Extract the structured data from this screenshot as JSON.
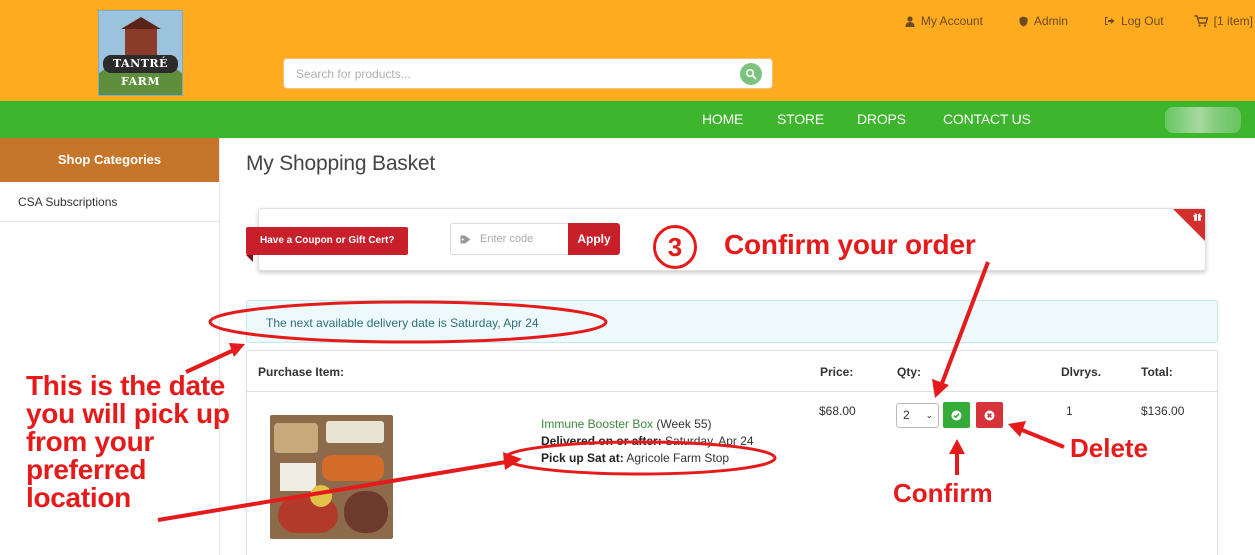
{
  "header": {
    "logo_text": "TANTRÉ FARM",
    "search_placeholder": "Search for products...",
    "account_links": [
      {
        "label": "My Account",
        "icon": "user-icon"
      },
      {
        "label": "Admin",
        "icon": "shield-icon"
      },
      {
        "label": "Log Out",
        "icon": "sign-out-icon"
      },
      {
        "label": "[1 item]",
        "icon": "cart-icon"
      }
    ]
  },
  "nav": {
    "items": [
      "HOME",
      "STORE",
      "DROPS",
      "CONTACT US"
    ]
  },
  "sidebar": {
    "title": "Shop Categories",
    "items": [
      "CSA Subscriptions"
    ]
  },
  "main": {
    "title": "My Shopping Basket",
    "coupon": {
      "label": "Have a Coupon or Gift Cert?",
      "placeholder": "Enter code",
      "apply_label": "Apply"
    },
    "notice": "The next available delivery date is Saturday, Apr 24",
    "table": {
      "headers": [
        "Purchase Item:",
        "Price:",
        "Qty:",
        "Dlvrys.",
        "Total:"
      ],
      "row": {
        "name": "Immune Booster Box",
        "week": "(Week 55)",
        "delivered_label": "Delivered on or after:",
        "delivered_value": "Saturday, Apr 24",
        "pickup_label": "Pick up Sat at:",
        "pickup_value": "Agricole Farm Stop",
        "price": "$68.00",
        "qty": "2",
        "deliveries": "1",
        "total": "$136.00"
      }
    }
  },
  "annotations": {
    "step_number": "3",
    "step_text": "Confirm your order",
    "date_note": [
      "This is the date",
      "you will pick up",
      "from your",
      "preferred",
      "location"
    ],
    "confirm_label": "Confirm",
    "delete_label": "Delete",
    "color": "#e51b1b"
  },
  "colors": {
    "header_bg": "#ffab1f",
    "nav_bg": "#3db52c",
    "sidebar_head": "#c6762b",
    "coupon_red": "#c8202b",
    "confirm_green": "#36ab3a",
    "delete_red": "#d6333b"
  }
}
